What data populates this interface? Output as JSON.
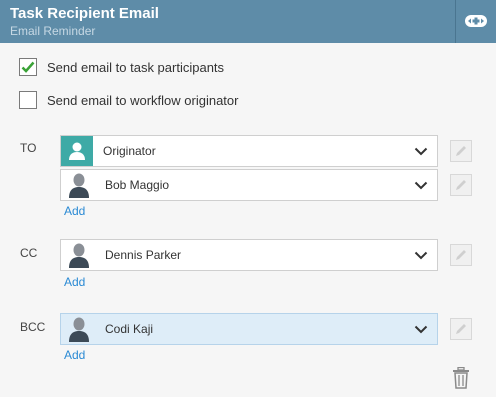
{
  "header": {
    "title": "Task Recipient Email",
    "subtitle": "Email Reminder"
  },
  "options": [
    {
      "label": "Send email to task participants",
      "checked": true
    },
    {
      "label": "Send email to workflow originator",
      "checked": false
    }
  ],
  "to": {
    "label": "TO",
    "recipients": [
      {
        "name": "Originator",
        "icon": "originator-icon"
      },
      {
        "name": "Bob Maggio",
        "icon": "user-icon"
      }
    ],
    "add_label": "Add"
  },
  "cc": {
    "label": "CC",
    "recipients": [
      {
        "name": "Dennis Parker",
        "icon": "user-icon"
      }
    ],
    "add_label": "Add"
  },
  "bcc": {
    "label": "BCC",
    "recipients": [
      {
        "name": "Codi Kaji",
        "icon": "user-icon",
        "selected": true
      }
    ],
    "add_label": "Add"
  },
  "colors": {
    "header_bg": "#5e8ca8",
    "accent_teal": "#3eaaa6",
    "link_blue": "#2a8ad4",
    "check_green": "#3aa236",
    "selected_bg": "#deedf8"
  }
}
